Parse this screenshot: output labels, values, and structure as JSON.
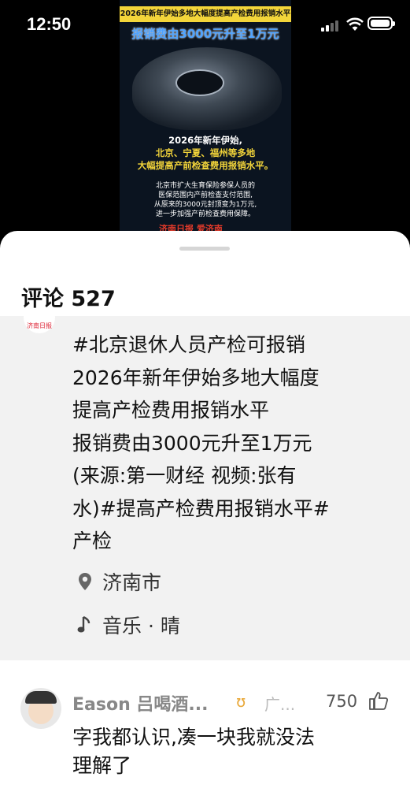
{
  "status_bar": {
    "time": "12:50"
  },
  "video": {
    "title": "2026年新年伊始多地大幅度提高产检费用报销水平",
    "headline": "报销费由3000元升至1万元",
    "line1": "2026年新年伊始,",
    "line2": "北京、宁夏、福州等多地",
    "line3": "大幅提高产前检查费用报销水平。",
    "detail1": "北京市扩大生育保险参保人员的",
    "detail2": "医保范围内产前检查支付范围,",
    "detail3": "从原来的3000元封顶变为1万元,",
    "detail4": "进一步加强产前检查费用保障。",
    "logo": "济南日报 爱济南"
  },
  "sheet": {
    "comments_label": "评论 527",
    "post_avatar_text": "济南日报",
    "post_lines": [
      "#北京退休人员产检可报销",
      "2026年新年伊始多地大幅度",
      "提高产检费用报销水平",
      "报销费由3000元升至1万元",
      "(来源:第一财经 视频:张有",
      "水)#提高产检费用报销水平#",
      "产检"
    ],
    "location": "济南市",
    "music": "音乐 · 晴"
  },
  "comment": {
    "name": "Eason 吕喝酒...",
    "badge": "ʊ",
    "ad": "广...",
    "likes": "750",
    "text_lines": [
      "字我都认识,凑一块我就没法",
      "理解了"
    ]
  }
}
